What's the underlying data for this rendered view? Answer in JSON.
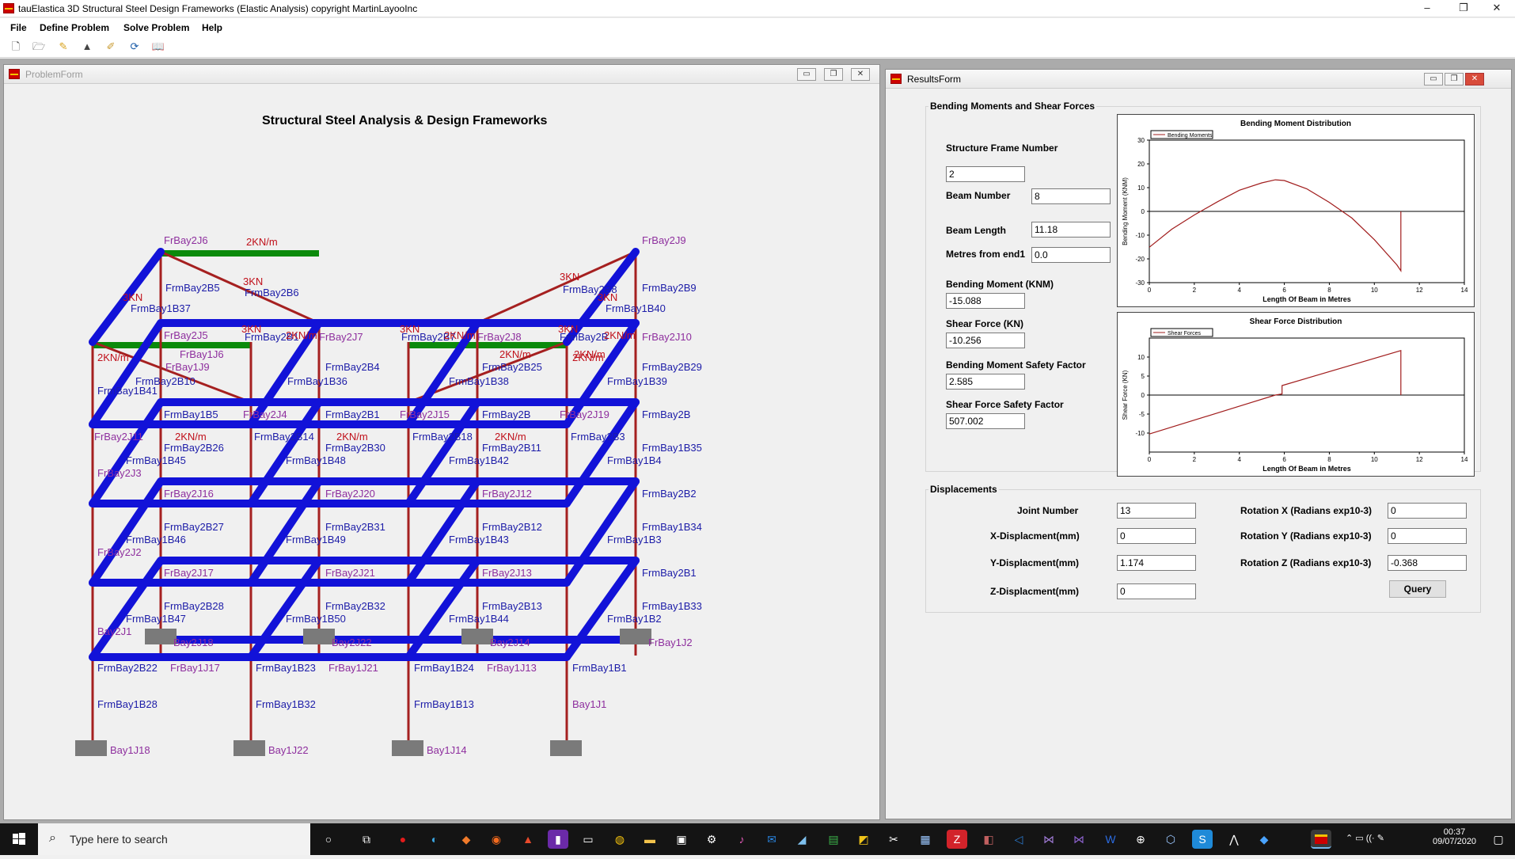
{
  "app": {
    "title": "tauElastica 3D Structural Steel Design Frameworks (Elastic Analysis) copyright MartinLayooInc",
    "controls": {
      "minimize": "–",
      "restore": "❐",
      "close": "✕"
    }
  },
  "menu": [
    "File",
    "Define Problem",
    "Solve Problem",
    "Help"
  ],
  "toolbar": [
    "new-icon",
    "open-icon",
    "edit-icon",
    "lock-icon",
    "pen-icon",
    "refresh-icon",
    "book-icon"
  ],
  "problem_form": {
    "title": "ProblemForm",
    "heading": "Structural Steel Analysis & Design Frameworks",
    "labels": [
      {
        "text": "FrBay2J6",
        "color": "#8e2f9e"
      },
      {
        "text": "2KN/m",
        "color": "#c0101a"
      },
      {
        "text": "FrBay2J9",
        "color": "#8e2f9e"
      },
      {
        "text": "FrmBay2B5",
        "color": "#1c1ca8"
      },
      {
        "text": "3KN",
        "color": "#c0101a"
      },
      {
        "text": "FrmBay2B6",
        "color": "#1c1ca8"
      },
      {
        "text": "3KN",
        "color": "#c0101a"
      },
      {
        "text": "FrmBay2B8",
        "color": "#1c1ca8"
      },
      {
        "text": "FrmBay2B9",
        "color": "#1c1ca8"
      },
      {
        "text": "3KN",
        "color": "#c0101a"
      },
      {
        "text": "FrmBay1B37",
        "color": "#1c1ca8"
      },
      {
        "text": "3KN",
        "color": "#c0101a"
      },
      {
        "text": "FrmBay1B40",
        "color": "#1c1ca8"
      },
      {
        "text": "FrBay2J5",
        "color": "#8e2f9e"
      },
      {
        "text": "3KN",
        "color": "#c0101a"
      },
      {
        "text": "FrmBay2B1",
        "color": "#1c1ca8"
      },
      {
        "text": "2KN/m",
        "color": "#c0101a"
      },
      {
        "text": "FrBay2J7",
        "color": "#8e2f9e"
      },
      {
        "text": "3KN",
        "color": "#c0101a"
      },
      {
        "text": "FrmBay2B7",
        "color": "#1c1ca8"
      },
      {
        "text": "2KN/m",
        "color": "#c0101a"
      },
      {
        "text": "FrBay2J8",
        "color": "#8e2f9e"
      },
      {
        "text": "3KN",
        "color": "#c0101a"
      },
      {
        "text": "FrmBay2B",
        "color": "#1c1ca8"
      },
      {
        "text": "2KN/m",
        "color": "#c0101a"
      },
      {
        "text": "FrBay2J10",
        "color": "#8e2f9e"
      },
      {
        "text": "2KN/m",
        "color": "#c0101a"
      },
      {
        "text": "FrBay1J6",
        "color": "#8e2f9e"
      },
      {
        "text": "2KN/m",
        "color": "#c0101a"
      },
      {
        "text": "2KN/m",
        "color": "#c0101a"
      },
      {
        "text": "2KN/m",
        "color": "#c0101a"
      },
      {
        "text": "FrBay1J9",
        "color": "#8e2f9e"
      },
      {
        "text": "FrmBay2B4",
        "color": "#1c1ca8"
      },
      {
        "text": "FrmBay2B25",
        "color": "#1c1ca8"
      },
      {
        "text": "FrmBay2B29",
        "color": "#1c1ca8"
      },
      {
        "text": "FrmBay2B10",
        "color": "#1c1ca8"
      },
      {
        "text": "FrmBay1B36",
        "color": "#1c1ca8"
      },
      {
        "text": "FrmBay1B38",
        "color": "#1c1ca8"
      },
      {
        "text": "FrmBay1B39",
        "color": "#1c1ca8"
      },
      {
        "text": "FrmBay1B41",
        "color": "#1c1ca8"
      },
      {
        "text": "FrmBay1B5",
        "color": "#1c1ca8"
      },
      {
        "text": "FrBay2J4",
        "color": "#8e2f9e"
      },
      {
        "text": "FrmBay2B1",
        "color": "#1c1ca8"
      },
      {
        "text": "FrBay2J15",
        "color": "#8e2f9e"
      },
      {
        "text": "FrmBay2B",
        "color": "#1c1ca8"
      },
      {
        "text": "FrBay2J19",
        "color": "#8e2f9e"
      },
      {
        "text": "FrmBay2B",
        "color": "#1c1ca8"
      },
      {
        "text": "FrBay2J11",
        "color": "#8e2f9e"
      },
      {
        "text": "2KN/m",
        "color": "#c0101a"
      },
      {
        "text": "FrmBay2B14",
        "color": "#1c1ca8"
      },
      {
        "text": "2KN/m",
        "color": "#c0101a"
      },
      {
        "text": "FrmBay2B18",
        "color": "#1c1ca8"
      },
      {
        "text": "2KN/m",
        "color": "#c0101a"
      },
      {
        "text": "FrmBay2B3",
        "color": "#1c1ca8"
      },
      {
        "text": "FrmBay2B26",
        "color": "#1c1ca8"
      },
      {
        "text": "FrmBay2B30",
        "color": "#1c1ca8"
      },
      {
        "text": "FrmBay2B11",
        "color": "#1c1ca8"
      },
      {
        "text": "FrmBay1B35",
        "color": "#1c1ca8"
      },
      {
        "text": "FrmBay1B45",
        "color": "#1c1ca8"
      },
      {
        "text": "FrmBay1B48",
        "color": "#1c1ca8"
      },
      {
        "text": "FrmBay1B42",
        "color": "#1c1ca8"
      },
      {
        "text": "FrmBay1B4",
        "color": "#1c1ca8"
      },
      {
        "text": "FrBay2J3",
        "color": "#8e2f9e"
      },
      {
        "text": "FrBay2J16",
        "color": "#8e2f9e"
      },
      {
        "text": "FrBay2J20",
        "color": "#8e2f9e"
      },
      {
        "text": "FrBay2J12",
        "color": "#8e2f9e"
      },
      {
        "text": "FrmBay2B2",
        "color": "#1c1ca8"
      },
      {
        "text": "FrmBay2B27",
        "color": "#1c1ca8"
      },
      {
        "text": "FrmBay2B31",
        "color": "#1c1ca8"
      },
      {
        "text": "FrmBay2B12",
        "color": "#1c1ca8"
      },
      {
        "text": "FrmBay1B34",
        "color": "#1c1ca8"
      },
      {
        "text": "FrmBay1B46",
        "color": "#1c1ca8"
      },
      {
        "text": "FrmBay1B49",
        "color": "#1c1ca8"
      },
      {
        "text": "FrmBay1B43",
        "color": "#1c1ca8"
      },
      {
        "text": "FrmBay1B3",
        "color": "#1c1ca8"
      },
      {
        "text": "FrBay2J2",
        "color": "#8e2f9e"
      },
      {
        "text": "FrBay2J17",
        "color": "#8e2f9e"
      },
      {
        "text": "FrBay2J21",
        "color": "#8e2f9e"
      },
      {
        "text": "FrBay2J13",
        "color": "#8e2f9e"
      },
      {
        "text": "FrmBay2B1",
        "color": "#1c1ca8"
      },
      {
        "text": "FrmBay2B28",
        "color": "#1c1ca8"
      },
      {
        "text": "FrmBay2B32",
        "color": "#1c1ca8"
      },
      {
        "text": "FrmBay2B13",
        "color": "#1c1ca8"
      },
      {
        "text": "FrmBay1B33",
        "color": "#1c1ca8"
      },
      {
        "text": "FrmBay1B47",
        "color": "#1c1ca8"
      },
      {
        "text": "FrmBay1B50",
        "color": "#1c1ca8"
      },
      {
        "text": "FrmBay1B44",
        "color": "#1c1ca8"
      },
      {
        "text": "FrmBay1B2",
        "color": "#1c1ca8"
      },
      {
        "text": "Bay2J1",
        "color": "#8e2f9e"
      },
      {
        "text": "Bay2J18",
        "color": "#8e2f9e"
      },
      {
        "text": "Bay2J22",
        "color": "#8e2f9e"
      },
      {
        "text": "Bay2J14",
        "color": "#8e2f9e"
      },
      {
        "text": "FrBay1J2",
        "color": "#8e2f9e"
      },
      {
        "text": "FrmBay2B22",
        "color": "#1c1ca8"
      },
      {
        "text": "FrBay1J17",
        "color": "#8e2f9e"
      },
      {
        "text": "FrmBay1B23",
        "color": "#1c1ca8"
      },
      {
        "text": "FrBay1J21",
        "color": "#8e2f9e"
      },
      {
        "text": "FrmBay1B24",
        "color": "#1c1ca8"
      },
      {
        "text": "FrBay1J13",
        "color": "#8e2f9e"
      },
      {
        "text": "FrmBay1B1",
        "color": "#1c1ca8"
      },
      {
        "text": "FrmBay1B28",
        "color": "#1c1ca8"
      },
      {
        "text": "FrmBay1B32",
        "color": "#1c1ca8"
      },
      {
        "text": "FrmBay1B13",
        "color": "#1c1ca8"
      },
      {
        "text": "Bay1J1",
        "color": "#8e2f9e"
      },
      {
        "text": "Bay1J18",
        "color": "#8e2f9e"
      },
      {
        "text": "Bay1J22",
        "color": "#8e2f9e"
      },
      {
        "text": "Bay1J14",
        "color": "#8e2f9e"
      }
    ]
  },
  "results_form": {
    "title": "ResultsForm",
    "bm_group": "Bending Moments and Shear Forces",
    "structure_frame_number_label": "Structure Frame Number",
    "structure_frame_number": "2",
    "beam_number_label": "Beam Number",
    "beam_number": "8",
    "beam_length_label": "Beam Length",
    "beam_length": "11.18",
    "metres_label": "Metres from end1",
    "metres": "0.0",
    "bending_moment_label": "Bending Moment (KNM)",
    "bending_moment": "-15.088",
    "shear_force_label": "Shear Force (KN)",
    "shear_force": "-10.256",
    "bm_safety_label": "Bending Moment Safety Factor",
    "bm_safety": "2.585",
    "sf_safety_label": "Shear Force Safety Factor",
    "sf_safety": "507.002",
    "disp_group": "Displacements",
    "joint_number_label": "Joint Number",
    "joint_number": "13",
    "xdisp_label": "X-Displacment(mm)",
    "xdisp": "0",
    "ydisp_label": "Y-Displacment(mm)",
    "ydisp": "1.174",
    "zdisp_label": "Z-Displacment(mm)",
    "zdisp": "0",
    "rotx_label": "Rotation X (Radians exp10-3)",
    "rotx": "0",
    "roty_label": "Rotation Y (Radians exp10-3)",
    "roty": "0",
    "rotz_label": "Rotation Z (Radians exp10-3)",
    "rotz": "-0.368",
    "query_label": "Query"
  },
  "chart_data": [
    {
      "type": "line",
      "title": "Bending Moment Distribution",
      "xlabel": "Length Of Beam in Metres",
      "ylabel": "Bending Moment (KNM)",
      "legend": "Bending Moments",
      "legend_position": "top-left",
      "xlim": [
        0,
        14
      ],
      "ylim": [
        -30,
        30
      ],
      "xticks": [
        "0",
        "2",
        "4",
        "6",
        "8",
        "10",
        "12",
        "14"
      ],
      "yticks": [
        "30",
        "20",
        "10",
        "0",
        "-10",
        "-20",
        "-30"
      ],
      "x": [
        0,
        1,
        2,
        3,
        4,
        5,
        5.6,
        6,
        7,
        8,
        9,
        10,
        11,
        11.18,
        11.18
      ],
      "y": [
        -15.088,
        -7.5,
        -1.5,
        3.9,
        8.9,
        12.0,
        13.3,
        13.0,
        9.5,
        3.8,
        -2.8,
        -11.9,
        -22.5,
        -25.0,
        0
      ],
      "colors": {
        "line": "#a11d1d"
      }
    },
    {
      "type": "line",
      "title": "Shear Force Distribution",
      "xlabel": "Length Of Beam in Metres",
      "ylabel": "Shear Force (KN)",
      "legend": "Shear Forces",
      "legend_position": "top-left",
      "xlim": [
        0,
        14
      ],
      "ylim": [
        -15,
        15
      ],
      "xticks": [
        "0",
        "2",
        "4",
        "6",
        "8",
        "10",
        "12",
        "14"
      ],
      "yticks": [
        "10",
        "5",
        "0",
        "-5",
        "-10"
      ],
      "x": [
        0,
        5.6,
        5.9,
        5.9,
        11.18,
        11.18
      ],
      "y": [
        -10.256,
        0,
        0.3,
        2.5,
        11.7,
        0
      ],
      "colors": {
        "line": "#a11d1d"
      }
    }
  ],
  "taskbar": {
    "search_placeholder": "Type here to search",
    "time": "00:37",
    "date": "09/07/2020"
  }
}
